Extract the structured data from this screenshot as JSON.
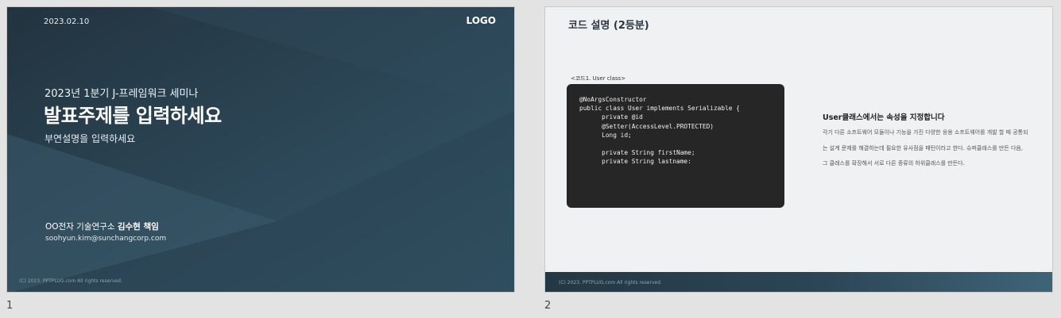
{
  "slides": [
    {
      "number": "1",
      "date": "2023.02.10",
      "logo": "LOGO",
      "subtitle": "2023년 1분기 J-프레임워크 세미나",
      "title": "발표주제를 입력하세요",
      "description": "부연설명을 입력하세요",
      "author_org": "OO전자 기술연구소 ",
      "author_name": "김수현 책임",
      "email": "soohyun.kim@sunchangcorp.com",
      "copyright": "(C) 2023. PPTPLUG.com All rights reserved."
    },
    {
      "number": "2",
      "heading": "코드 설명 (2등분)",
      "code_caption": "<코드1. User class>",
      "code_lines": [
        "@NoArgsConstructor",
        "public class User implements Serializable {",
        "      private @id",
        "      @Setter(AccessLevel.PROTECTED)",
        "      Long id;",
        "",
        "      private String firstName;",
        "      private String lastname:"
      ],
      "right_title": "User클래스에서는 속성을 지정합니다",
      "right_body": "각기 다른 소프트웨어 모듈이나 기능을 가진 다양한 응용 소프트웨어를 개발 할 때 공통되는 설계 문제를 해결하는데 필요한 유사점을 패턴이라고 한다. 슈퍼클래스를 만든 다음, 그 클래스를 확장해서 서로 다른 종류의 하위클래스를 만든다.",
      "copyright": "(C) 2023. PPTPLUG.com All rights reserved."
    }
  ]
}
